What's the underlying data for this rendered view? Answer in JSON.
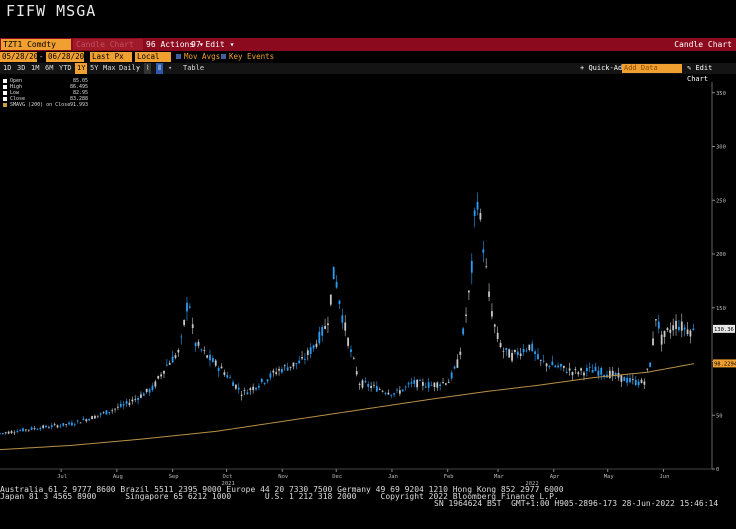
{
  "title": "FIFW MSGA",
  "toolbar": {
    "ticker": "TZT1 Comdty",
    "ghost_field": "Candle Chart",
    "actions_label": "Actions",
    "edit_label": "Edit",
    "chart_name": "Candle Chart"
  },
  "controls": {
    "start_date": "05/28/2021",
    "end_date": "06/28/2022",
    "price_field": "Last Px",
    "currency": "Local CCY",
    "mov_avgs_label": "Mov Avgs",
    "key_events_label": "Key Events"
  },
  "periods": [
    "1D",
    "3D",
    "1M",
    "6M",
    "YTD",
    "1Y",
    "5Y",
    "Max",
    "Daily"
  ],
  "active_period": "1Y",
  "table_label": "Table",
  "quick_add_label": "Quick-Add",
  "add_data_placeholder": "Add Data",
  "edit_chart_label": "Edit Chart",
  "legend": [
    {
      "label": "Open",
      "value": "85.05",
      "color": "#ffffff"
    },
    {
      "label": "High",
      "value": "86.495",
      "color": "#ffffff"
    },
    {
      "label": "Low",
      "value": "82.95",
      "color": "#ffffff"
    },
    {
      "label": "Close",
      "value": "83.288",
      "color": "#ffffff"
    },
    {
      "label": "SMAVG (200) on Close",
      "value": "91.993",
      "color": "#c8a040"
    }
  ],
  "colors": {
    "up": "#2a9df4",
    "down": "#c8c8c8",
    "sma": "#b89048",
    "last_price_tag": "#e8e8e8",
    "sma_tag": "#f0a030"
  },
  "chart_data": {
    "type": "candlestick",
    "ylim": [
      0,
      360
    ],
    "yticks": [
      0,
      50,
      100,
      150,
      200,
      250,
      300,
      350
    ],
    "last_price_label": "130.36",
    "sma_label": "98.2294",
    "last_price_value": 130.36,
    "sma_value": 98.2294,
    "months": [
      {
        "label": "Jul",
        "day": 34
      },
      {
        "label": "Aug",
        "day": 65
      },
      {
        "label": "Sep",
        "day": 96
      },
      {
        "label": "Oct",
        "day": 126
      },
      {
        "label": "Nov",
        "day": 157
      },
      {
        "label": "Dec",
        "day": 187
      },
      {
        "label": "Jan",
        "day": 218
      },
      {
        "label": "Feb",
        "day": 249
      },
      {
        "label": "Mar",
        "day": 277
      },
      {
        "label": "Apr",
        "day": 308
      },
      {
        "label": "May",
        "day": 338
      },
      {
        "label": "Jun",
        "day": 369
      }
    ],
    "year_labels": [
      {
        "label": "2021",
        "day": 126
      },
      {
        "label": "2022",
        "day": 295
      }
    ],
    "x_range_days": [
      0,
      396
    ],
    "close_path": [
      [
        0,
        33
      ],
      [
        20,
        38
      ],
      [
        40,
        42
      ],
      [
        55,
        50
      ],
      [
        70,
        60
      ],
      [
        85,
        75
      ],
      [
        92,
        95
      ],
      [
        100,
        110
      ],
      [
        105,
        162
      ],
      [
        108,
        118
      ],
      [
        115,
        105
      ],
      [
        125,
        90
      ],
      [
        135,
        70
      ],
      [
        145,
        80
      ],
      [
        155,
        92
      ],
      [
        160,
        95
      ],
      [
        168,
        100
      ],
      [
        175,
        115
      ],
      [
        182,
        135
      ],
      [
        186,
        185
      ],
      [
        190,
        145
      ],
      [
        195,
        110
      ],
      [
        200,
        80
      ],
      [
        210,
        75
      ],
      [
        220,
        70
      ],
      [
        230,
        80
      ],
      [
        240,
        78
      ],
      [
        250,
        82
      ],
      [
        255,
        100
      ],
      [
        258,
        130
      ],
      [
        262,
        175
      ],
      [
        265,
        260
      ],
      [
        268,
        220
      ],
      [
        272,
        160
      ],
      [
        276,
        125
      ],
      [
        280,
        110
      ],
      [
        285,
        105
      ],
      [
        290,
        110
      ],
      [
        295,
        115
      ],
      [
        300,
        100
      ],
      [
        310,
        95
      ],
      [
        320,
        90
      ],
      [
        330,
        92
      ],
      [
        340,
        88
      ],
      [
        350,
        82
      ],
      [
        358,
        80
      ],
      [
        362,
        100
      ],
      [
        365,
        145
      ],
      [
        368,
        120
      ],
      [
        372,
        128
      ],
      [
        376,
        135
      ],
      [
        382,
        130
      ],
      [
        386,
        128
      ]
    ],
    "sma_path": [
      [
        0,
        18
      ],
      [
        40,
        22
      ],
      [
        80,
        28
      ],
      [
        120,
        35
      ],
      [
        160,
        45
      ],
      [
        200,
        55
      ],
      [
        240,
        65
      ],
      [
        270,
        72
      ],
      [
        300,
        78
      ],
      [
        330,
        85
      ],
      [
        360,
        90
      ],
      [
        386,
        98
      ]
    ]
  },
  "footer": {
    "line1": "Australia 61 2 9777 8600 Brazil 5511 2395 9000 Europe 44 20 7330 7500 Germany 49 69 9204 1210 Hong Kong 852 2977 6000",
    "line2": "Japan 81 3 4565 8900      Singapore 65 6212 1000       U.S. 1 212 318 2000     Copyright 2022 Bloomberg Finance L.P.",
    "line3": "SN 1964624 BST  GMT+1:00 H905-2896-173 28-Jun-2022 15:46:14"
  }
}
